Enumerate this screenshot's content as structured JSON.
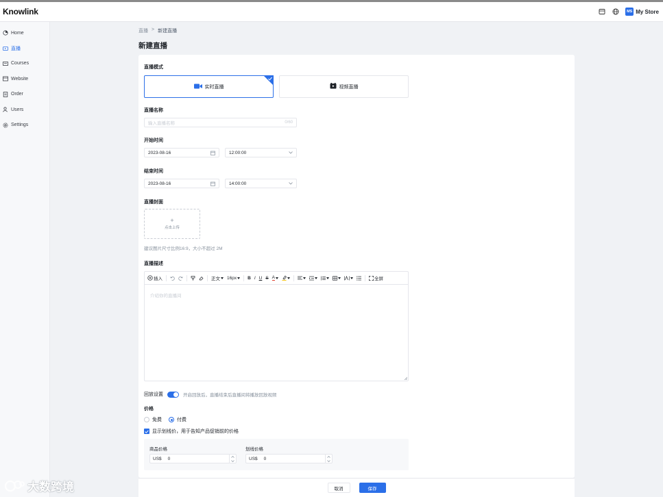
{
  "app": {
    "logo": "Knowlink"
  },
  "header": {
    "store_initials": "MS",
    "store_name": "My Store"
  },
  "sidebar": {
    "items": [
      {
        "label": "Home",
        "icon": "home-icon",
        "active": false
      },
      {
        "label": "直播",
        "icon": "live-icon",
        "active": true
      },
      {
        "label": "Courses",
        "icon": "courses-icon",
        "active": false
      },
      {
        "label": "Website",
        "icon": "website-icon",
        "active": false
      },
      {
        "label": "Order",
        "icon": "order-icon",
        "active": false
      },
      {
        "label": "Users",
        "icon": "users-icon",
        "active": false
      },
      {
        "label": "Settings",
        "icon": "settings-icon",
        "active": false
      }
    ]
  },
  "breadcrumb": {
    "parent": "直播",
    "separator": ">",
    "current": "新建直播"
  },
  "page": {
    "title": "新建直播"
  },
  "form": {
    "mode_label": "直播模式",
    "mode_realtime": "实时直播",
    "mode_video": "视频直播",
    "name_label": "直播名称",
    "name_placeholder": "输入直播名称",
    "name_counter": "0/60",
    "start_label": "开始时间",
    "start_date": "2023-08-16",
    "start_time": "12:00:00",
    "end_label": "结束时间",
    "end_date": "2023-08-16",
    "end_time": "14:00:00",
    "cover_label": "直播封面",
    "upload_plus": "+",
    "upload_text": "点击上传",
    "cover_hint": "建议图片尺寸比例16:9，大小不超过 2M",
    "desc_label": "直播描述",
    "desc_placeholder": "介绍你的直播间",
    "replay_label": "回放设置",
    "replay_desc": "开启回放后，直播结束后直播间将播放回放视频",
    "price_label": "价格",
    "price_free": "免费",
    "price_paid": "付费",
    "strike_checkbox": "显示划线价，用于告知产品促销前的价格",
    "goods_price_label": "商品价格",
    "strike_price_label": "划线价格",
    "currency": "US$",
    "goods_price_value": "0",
    "strike_price_value": "0"
  },
  "editor": {
    "insert": "插入",
    "text_style": "正文",
    "font_size": "16px",
    "bold": "B",
    "italic": "I",
    "underline": "U",
    "strike": "S",
    "font_color": "A",
    "fullscreen": "全屏"
  },
  "footer": {
    "cancel": "取消",
    "save": "保存"
  },
  "watermark": {
    "text": "大数跨境"
  },
  "colors": {
    "accent": "#2b6fe8",
    "border": "#e5e6eb",
    "muted": "#86909c"
  }
}
